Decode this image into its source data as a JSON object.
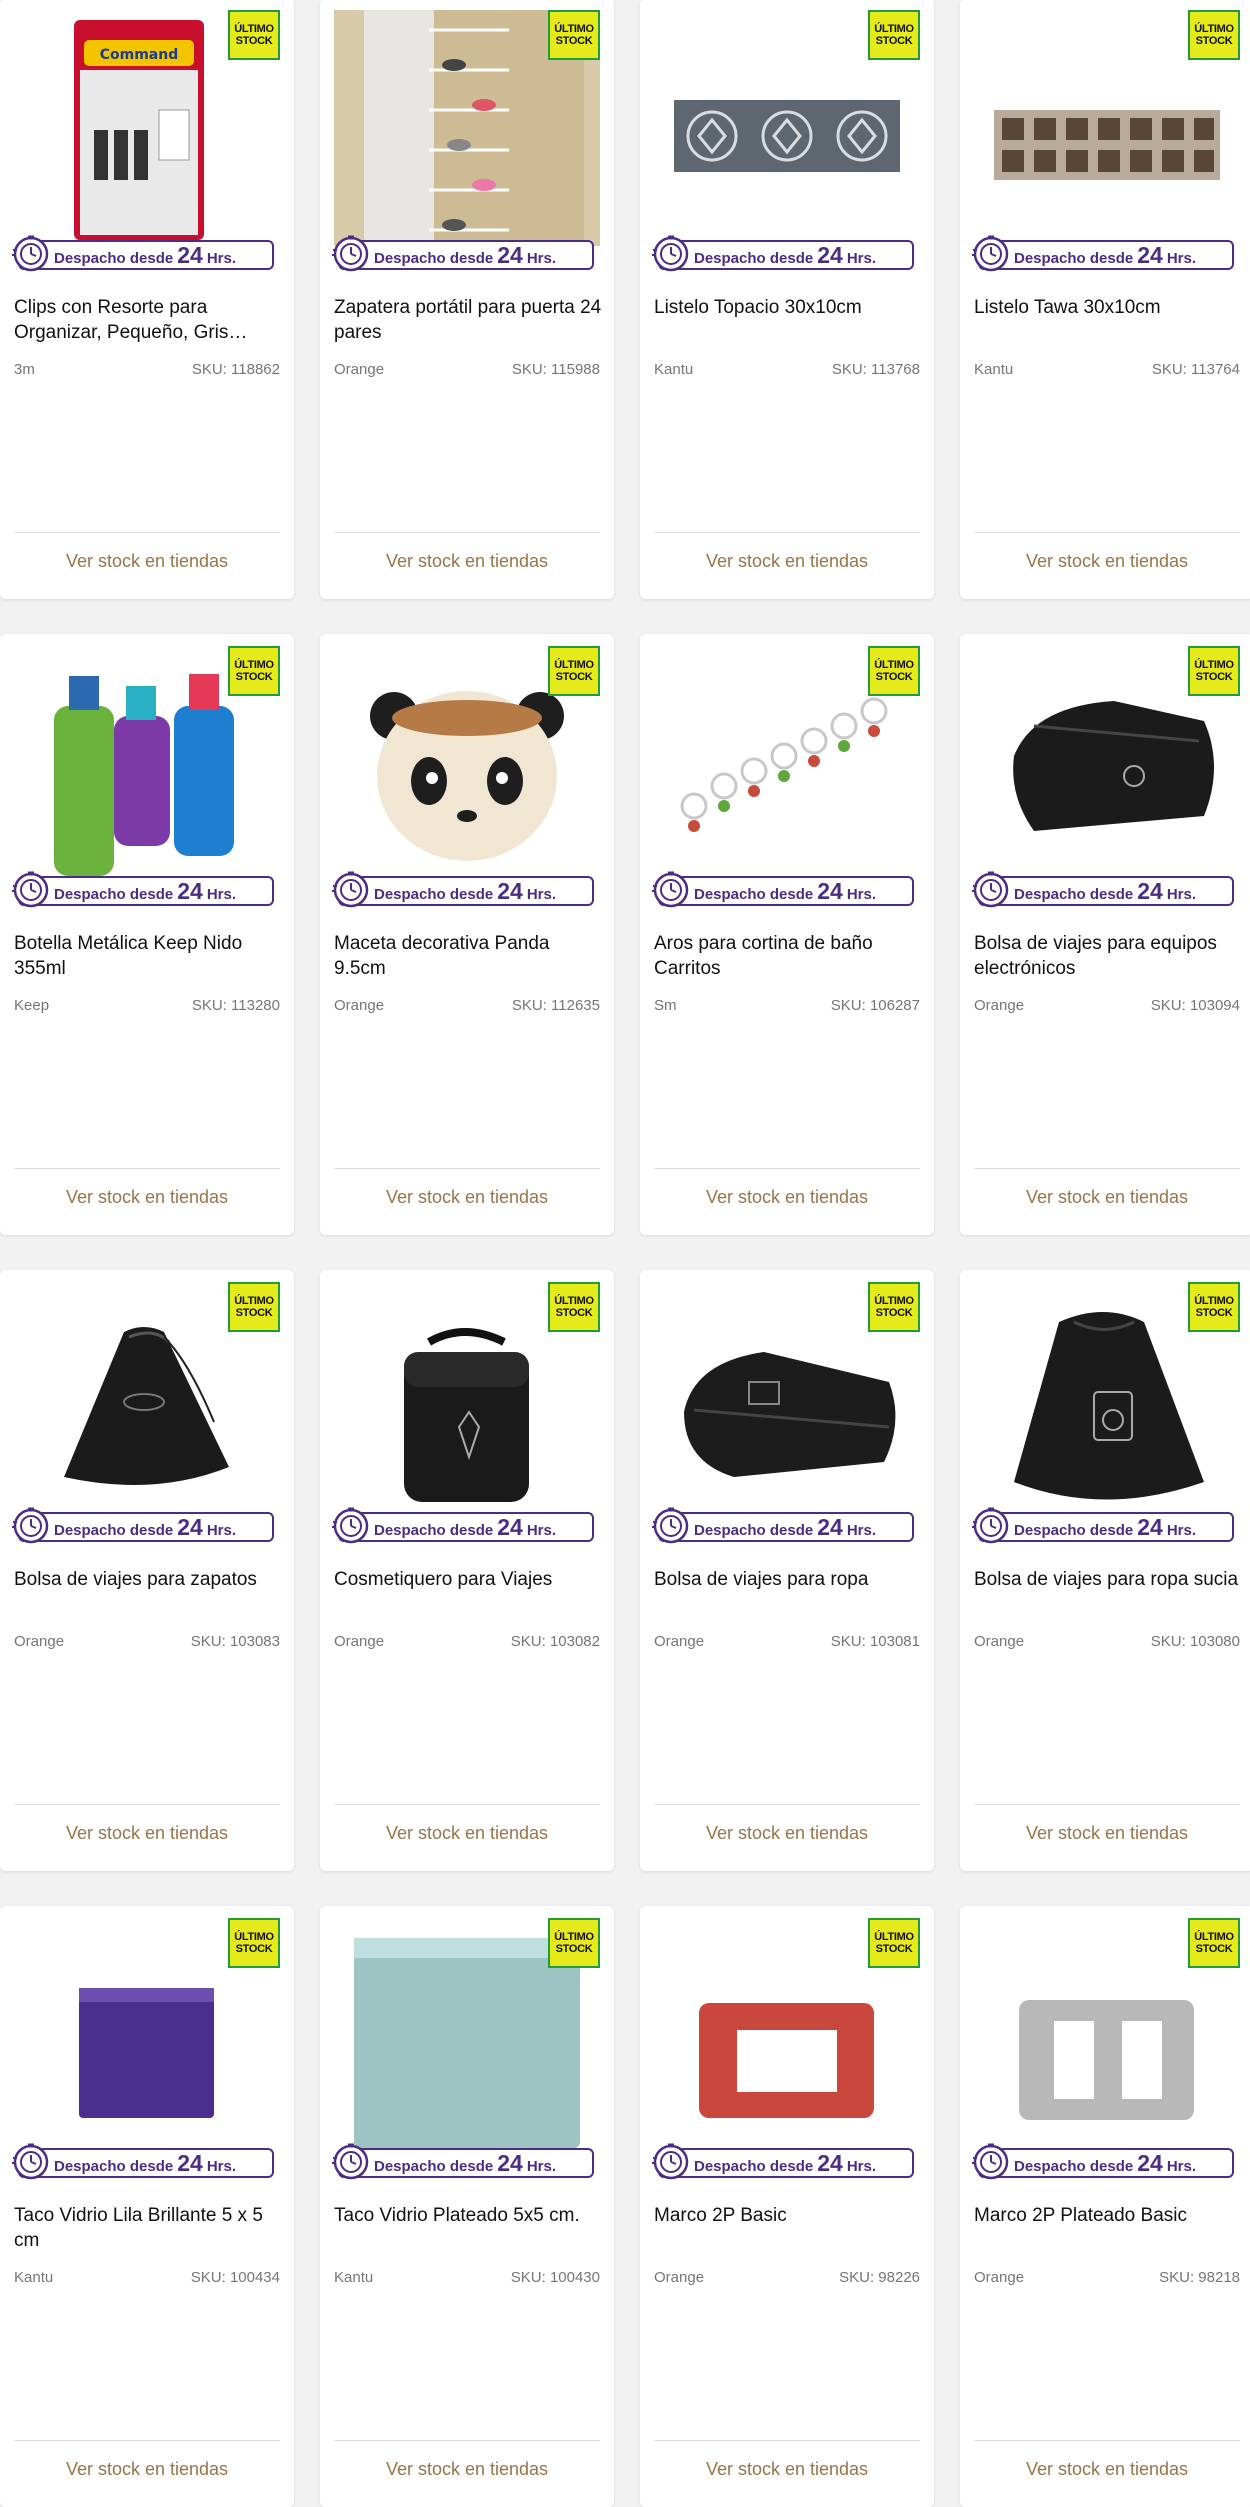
{
  "badge": {
    "ultimo_line1": "ÚLTIMO",
    "ultimo_line2": "STOCK",
    "despacho_prefix": "Despacho desde",
    "despacho_number": "24",
    "despacho_suffix": "Hrs."
  },
  "colors": {
    "badge_yellow": "#e6ea1a",
    "badge_green": "#1e9e3b",
    "despacho_purple": "#4b2d86",
    "stock_link": "#9a7447",
    "background": "#f2f2f2"
  },
  "stock_link_label": "Ver stock en tiendas",
  "products": [
    {
      "title": "Clips con Resorte para Organizar, Pequeño, Gris…",
      "brand": "3m",
      "sku": "SKU: 118862",
      "image": "command-hooks-package-icon"
    },
    {
      "title": "Zapatera portátil para puerta 24 pares",
      "brand": "Orange",
      "sku": "SKU: 115988",
      "image": "shoe-rack-door-icon"
    },
    {
      "title": "Listelo Topacio 30x10cm",
      "brand": "Kantu",
      "sku": "SKU: 113768",
      "image": "decorative-tile-strip-icon"
    },
    {
      "title": "Listelo Tawa 30x10cm",
      "brand": "Kantu",
      "sku": "SKU: 113764",
      "image": "mosaic-tile-strip-icon"
    },
    {
      "title": "Botella Metálica Keep Nido 355ml",
      "brand": "Keep",
      "sku": "SKU: 113280",
      "image": "metal-bottles-icon"
    },
    {
      "title": "Maceta decorativa Panda 9.5cm",
      "brand": "Orange",
      "sku": "SKU: 112635",
      "image": "panda-pot-icon"
    },
    {
      "title": "Aros para cortina de baño Carritos",
      "brand": "Sm",
      "sku": "SKU: 106287",
      "image": "curtain-hooks-icon"
    },
    {
      "title": "Bolsa de viajes para equipos electrónicos",
      "brand": "Orange",
      "sku": "SKU: 103094",
      "image": "travel-pouch-icon"
    },
    {
      "title": "Bolsa de viajes para zapatos",
      "brand": "Orange",
      "sku": "SKU: 103083",
      "image": "shoe-bag-icon"
    },
    {
      "title": "Cosmetiquero para Viajes",
      "brand": "Orange",
      "sku": "SKU: 103082",
      "image": "toiletry-bag-icon"
    },
    {
      "title": "Bolsa de viajes para ropa",
      "brand": "Orange",
      "sku": "SKU: 103081",
      "image": "clothes-bag-icon"
    },
    {
      "title": "Bolsa de viajes para ropa sucia",
      "brand": "Orange",
      "sku": "SKU: 103080",
      "image": "laundry-bag-icon"
    },
    {
      "title": "Taco Vidrio Lila Brillante 5 x 5 cm",
      "brand": "Kantu",
      "sku": "SKU: 100434",
      "image": "purple-glass-tile-icon"
    },
    {
      "title": "Taco Vidrio Plateado 5x5 cm.",
      "brand": "Kantu",
      "sku": "SKU: 100430",
      "image": "silver-glass-tile-icon"
    },
    {
      "title": "Marco 2P Basic",
      "brand": "Orange",
      "sku": "SKU: 98226",
      "image": "red-switch-frame-icon"
    },
    {
      "title": "Marco 2P Plateado Basic",
      "brand": "Orange",
      "sku": "SKU: 98218",
      "image": "silver-switch-frame-icon"
    }
  ]
}
